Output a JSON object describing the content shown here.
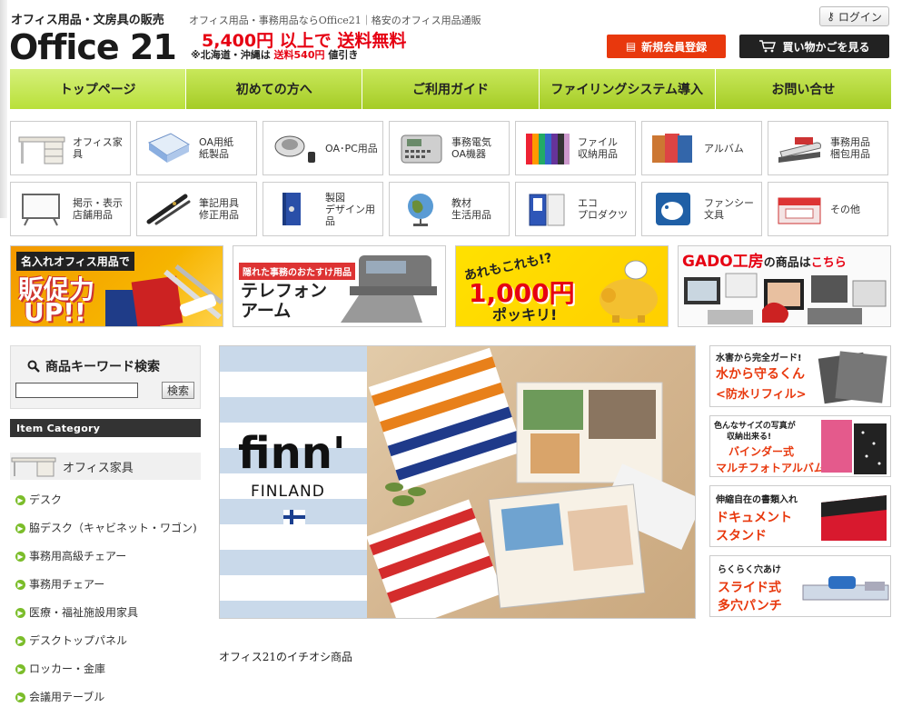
{
  "header": {
    "tagline": "オフィス用品・文房具の販売",
    "logo": "Office 21",
    "description": "オフィス用品・事務用品ならOffice21｜格安のオフィス用品通販",
    "shipping_main": "5,400円 以上で 送料無料",
    "shipping_note_prefix": "※北海道・沖縄は ",
    "shipping_note_red": "送料540円",
    "shipping_note_suffix": " 値引き",
    "login_label": "ログイン",
    "register_label": "新規会員登録",
    "cart_label": "買い物かごを見る"
  },
  "nav": {
    "items": [
      {
        "label": "トップページ"
      },
      {
        "label": "初めての方へ"
      },
      {
        "label": "ご利用ガイド"
      },
      {
        "label": "ファイリングシステム導入"
      },
      {
        "label": "お問い合せ"
      }
    ]
  },
  "categories": [
    {
      "label": "オフィス家具",
      "icon": "desk-icon"
    },
    {
      "label": "OA用紙\n紙製品",
      "icon": "paper-icon"
    },
    {
      "label": "OA･PC用品",
      "icon": "mouse-icon"
    },
    {
      "label": "事務電気\nOA機器",
      "icon": "label-printer-icon"
    },
    {
      "label": "ファイル\n収納用品",
      "icon": "binder-icon"
    },
    {
      "label": "アルバム",
      "icon": "album-icon"
    },
    {
      "label": "事務用品\n梱包用品",
      "icon": "stapler-icon"
    },
    {
      "label": "掲示・表示\n店舗用品",
      "icon": "whiteboard-icon"
    },
    {
      "label": "筆記用具\n修正用品",
      "icon": "pen-icon"
    },
    {
      "label": "製図\nデザイン用品",
      "icon": "ruler-icon"
    },
    {
      "label": "教材\n生活用品",
      "icon": "globe-icon"
    },
    {
      "label": "エコ\nプロダクツ",
      "icon": "eco-file-icon"
    },
    {
      "label": "ファンシー\n文具",
      "icon": "elephant-icon"
    },
    {
      "label": "その他",
      "icon": "box-icon"
    }
  ],
  "banners": {
    "b1_line1": "名入れオフィス用品で",
    "b1_line2": "販促力",
    "b1_line3": "UP!!",
    "b2_line1": "隠れた事務のおたすけ用品",
    "b2_line2": "テレフォン",
    "b2_line3": "アーム",
    "b3_line1": "あれもこれも!?",
    "b3_line2": "1,000円",
    "b3_line3": "ポッキリ!",
    "b4_title_a": "GADO工房",
    "b4_title_b": "の商品は",
    "b4_title_c": "こちら"
  },
  "search": {
    "title": "商品キーワード検索",
    "value": "",
    "button": "検索"
  },
  "sidebar": {
    "section_title": "Item Category",
    "main_category": "オフィス家具",
    "subcategories": [
      "デスク",
      "脇デスク（キャビネット・ワゴン)",
      "事務用高級チェアー",
      "事務用チェアー",
      "医療・福祉施設用家具",
      "デスクトップパネル",
      "ロッカー・金庫",
      "会議用テーブル"
    ]
  },
  "main_banner": {
    "brand": "finn'",
    "country": "FINLAND"
  },
  "side_ads": [
    {
      "line1": "水害から完全ガード!",
      "line2": "水から守るくん",
      "line3": "<防水リフィル>"
    },
    {
      "line1": "色んなサイズの写真が",
      "line2": "収納出来る!",
      "line3": "バインダー式",
      "line4": "マルチフォトアルバム"
    },
    {
      "line1": "伸縮自在の書類入れ",
      "line2": "ドキュメント",
      "line3": "スタンド"
    },
    {
      "line1": "らくらく穴あけ",
      "line2": "スライド式",
      "line3": "多穴パンチ"
    }
  ],
  "recommend_title": "オフィス21のイチオシ商品",
  "colors": {
    "nav_green": "#b5dc37",
    "accent_red": "#e60012",
    "register_orange": "#e8380d",
    "sidebar_dark": "#333333"
  }
}
